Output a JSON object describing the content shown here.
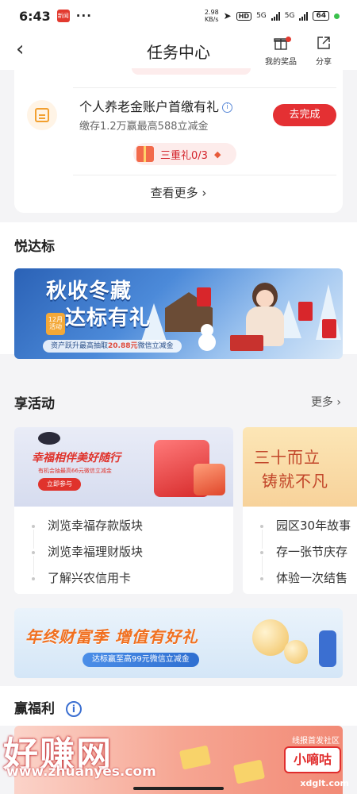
{
  "statusbar": {
    "time": "6:43",
    "app_badge": "新闻",
    "dots": "···",
    "net_speed_value": "2.98",
    "net_speed_unit": "KB/s",
    "hd": "HD",
    "net1": "5G",
    "net2": "5G",
    "battery": "64"
  },
  "header": {
    "title": "任务中心",
    "back_icon": "‹",
    "prizes_label": "我的奖品",
    "share_label": "分享"
  },
  "task": {
    "title": "个人养老金账户首缴有礼",
    "subtitle": "缴存1.2万赢最高588立减金",
    "button": "去完成",
    "gift_label": "三重礼0/3",
    "more": "查看更多 ›"
  },
  "section_yuedabiao": {
    "title": "悦达标",
    "banner": {
      "line1": "秋收冬藏",
      "line2": "达标有礼",
      "tag": "12月活动",
      "foot_prefix": "资产跃升最高抽取",
      "foot_amount": "20.88元",
      "foot_suffix": "微信立减金"
    }
  },
  "section_activity": {
    "title": "享活动",
    "more": "更多 ›",
    "card1": {
      "headline": "幸福相伴美好随行",
      "sub": "有机会抽最高66元微信立减金",
      "btn": "立即参与",
      "items": [
        "浏览幸福存款版块",
        "浏览幸福理财版块",
        "了解兴农信用卡"
      ]
    },
    "card2": {
      "line1": "三十而立",
      "line2": "铸就不凡",
      "items": [
        "园区30年故事",
        "存一张节庆存",
        "体验一次结售"
      ]
    }
  },
  "banner_year_end": {
    "title_a": "年终财富季",
    "title_b": "增值有好礼",
    "pill": "达标赢至高99元微信立减金"
  },
  "section_welfare": {
    "title": "赢福利",
    "info_icon": "i"
  },
  "watermark": {
    "brand": "好赚网",
    "url": "www.zhuanyes.com",
    "badge_top": "线报首发社区",
    "badge": "小嘀咕",
    "site": "xdglt.com"
  },
  "colors": {
    "primary_red": "#e43033",
    "page_bg": "#f4f4f6",
    "accent_orange": "#f2862a"
  },
  "icons": {
    "back": "chevron-left-icon",
    "prizes": "gift-icon",
    "share": "share-icon",
    "task": "calendar-icon",
    "info": "info-icon"
  }
}
